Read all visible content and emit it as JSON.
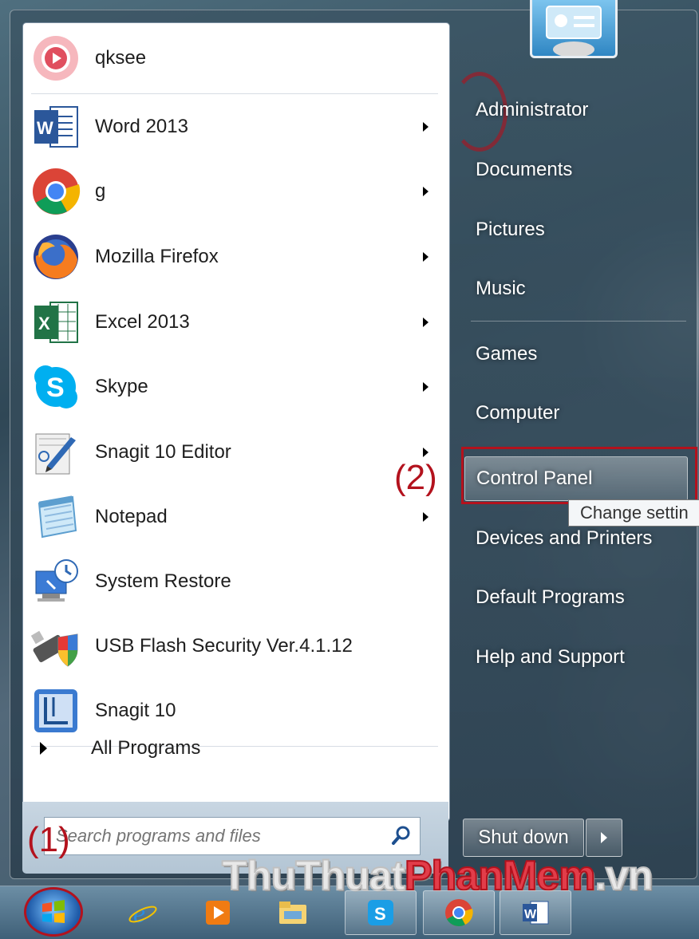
{
  "programs": [
    {
      "label": "qksee",
      "icon": "qksee-icon",
      "arrow": false
    },
    {
      "label": "Word 2013",
      "icon": "word-icon",
      "arrow": true
    },
    {
      "label": "g",
      "icon": "chrome-icon",
      "arrow": true
    },
    {
      "label": "Mozilla Firefox",
      "icon": "firefox-icon",
      "arrow": true
    },
    {
      "label": "Excel 2013",
      "icon": "excel-icon",
      "arrow": true
    },
    {
      "label": "Skype",
      "icon": "skype-icon",
      "arrow": true
    },
    {
      "label": "Snagit 10 Editor",
      "icon": "snagit-editor-icon",
      "arrow": true
    },
    {
      "label": "Notepad",
      "icon": "notepad-icon",
      "arrow": true
    },
    {
      "label": "System Restore",
      "icon": "system-restore-icon",
      "arrow": false
    },
    {
      "label": "USB Flash Security Ver.4.1.12",
      "icon": "usb-security-icon",
      "arrow": false
    },
    {
      "label": "Snagit 10",
      "icon": "snagit-icon",
      "arrow": false
    }
  ],
  "all_programs": "All Programs",
  "search": {
    "placeholder": "Search programs and files"
  },
  "right": {
    "items": [
      "Administrator",
      "Documents",
      "Pictures",
      "Music",
      "Games",
      "Computer",
      "Control Panel",
      "Devices and Printers",
      "Default Programs",
      "Help and Support"
    ],
    "tooltip": "Change settin",
    "shutdown": "Shut down"
  },
  "annotations": {
    "step1": "(1)",
    "step2": "(2)"
  },
  "watermark": {
    "part1": "ThuThuat",
    "part2": "PhanMem",
    "part3": ".vn"
  },
  "colors": {
    "annotation_red": "#b3121d"
  }
}
